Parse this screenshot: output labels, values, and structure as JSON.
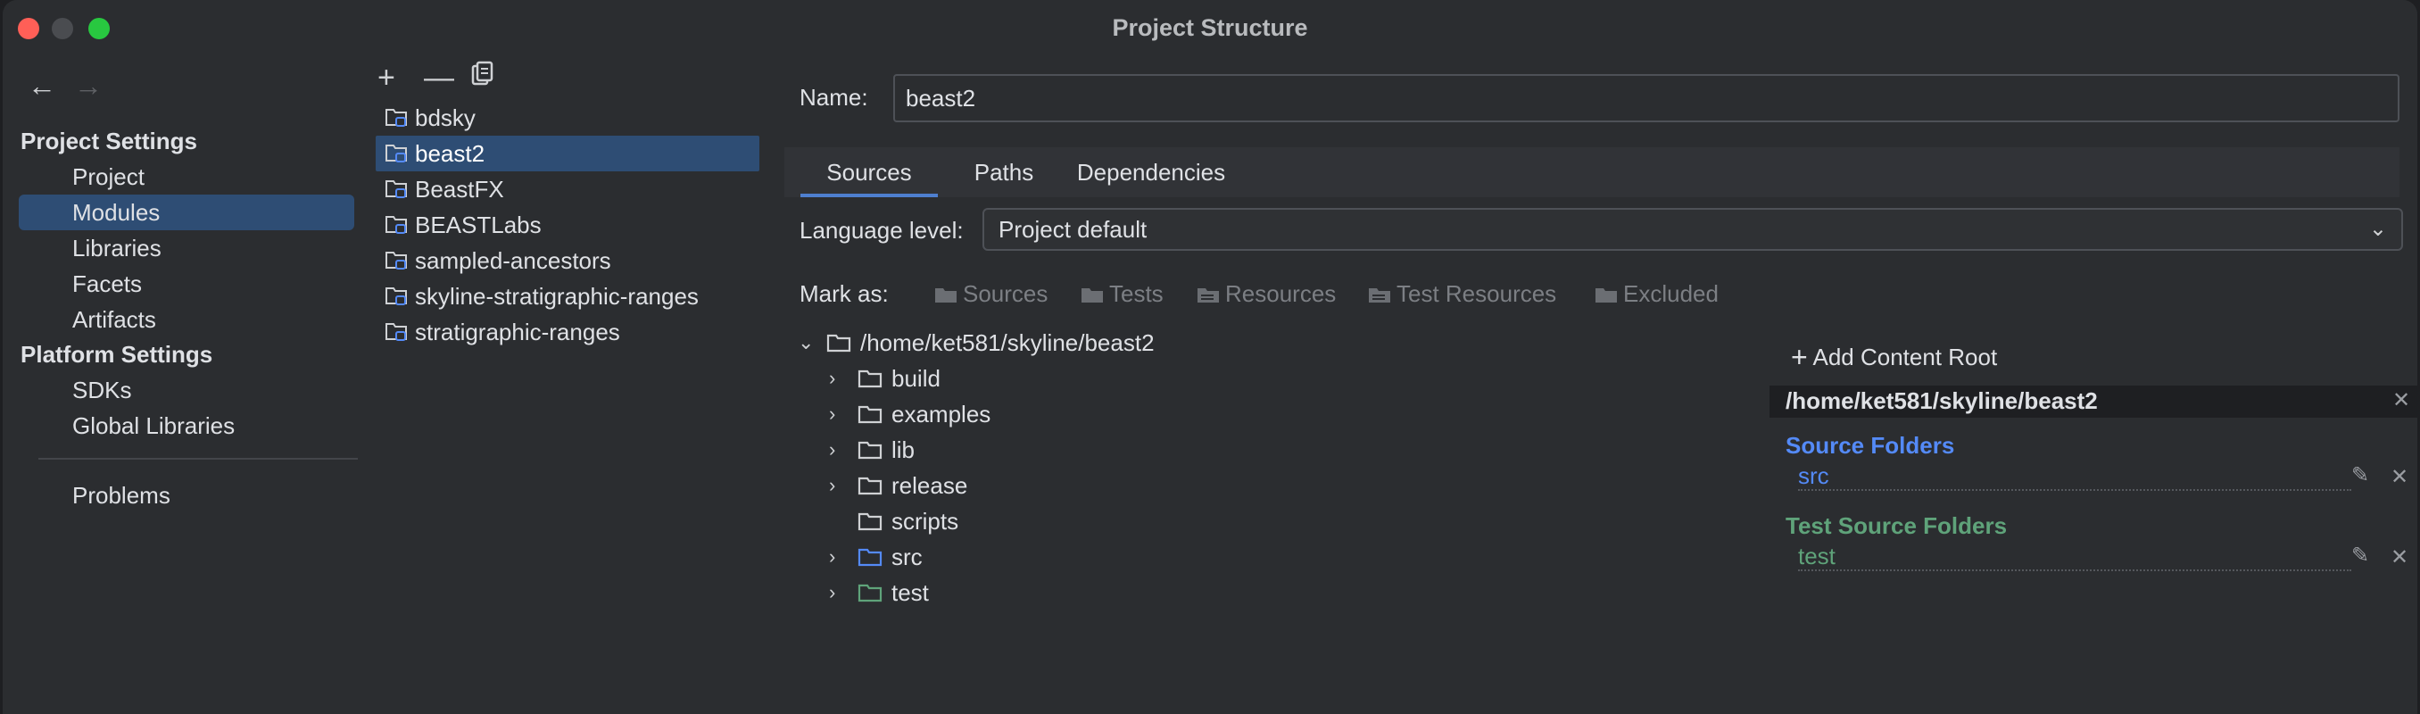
{
  "window": {
    "title": "Project Structure"
  },
  "nav": {
    "back": "←",
    "forward": "→",
    "project_settings_heading": "Project Settings",
    "items_project": [
      "Project",
      "Modules",
      "Libraries",
      "Facets",
      "Artifacts"
    ],
    "platform_settings_heading": "Platform Settings",
    "items_platform": [
      "SDKs",
      "Global Libraries"
    ],
    "problems": "Problems",
    "selected": "Modules"
  },
  "modules": {
    "tools": {
      "add": "+",
      "remove": "—",
      "copy": "copy"
    },
    "items": [
      "bdsky",
      "beast2",
      "BeastFX",
      "BEASTLabs",
      "sampled-ancestors",
      "skyline-stratigraphic-ranges",
      "stratigraphic-ranges"
    ],
    "selected": "beast2"
  },
  "detail": {
    "name_label": "Name:",
    "name_value": "beast2",
    "tabs": [
      "Sources",
      "Paths",
      "Dependencies"
    ],
    "active_tab": "Sources",
    "language_level_label": "Language level:",
    "language_level_value": "Project default",
    "mark_as_label": "Mark as:",
    "mark_as": [
      "Sources",
      "Tests",
      "Resources",
      "Test Resources",
      "Excluded"
    ],
    "tree": {
      "root": "/home/ket581/skyline/beast2",
      "children": [
        "build",
        "examples",
        "lib",
        "release",
        "scripts",
        "src",
        "test"
      ]
    },
    "content_root": {
      "add_label": "Add Content Root",
      "path": "/home/ket581/skyline/beast2",
      "source_folders_title": "Source Folders",
      "source_folder": "src",
      "test_source_folders_title": "Test Source Folders",
      "test_source_folder": "test"
    }
  },
  "colors": {
    "selection": "#2e4d74",
    "source_blue": "#548af7",
    "test_green": "#5fa37a",
    "accent_tab": "#4e7fcf"
  }
}
